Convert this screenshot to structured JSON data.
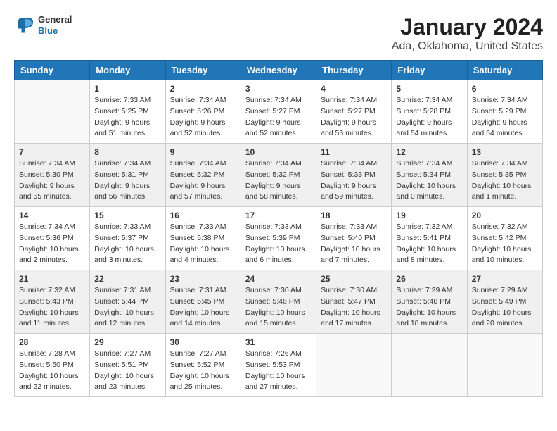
{
  "logo": {
    "line1": "General",
    "line2": "Blue"
  },
  "title": "January 2024",
  "subtitle": "Ada, Oklahoma, United States",
  "weekdays": [
    "Sunday",
    "Monday",
    "Tuesday",
    "Wednesday",
    "Thursday",
    "Friday",
    "Saturday"
  ],
  "weeks": [
    [
      {
        "day": "",
        "empty": true
      },
      {
        "day": "1",
        "sunrise": "Sunrise: 7:33 AM",
        "sunset": "Sunset: 5:25 PM",
        "daylight": "Daylight: 9 hours and 51 minutes."
      },
      {
        "day": "2",
        "sunrise": "Sunrise: 7:34 AM",
        "sunset": "Sunset: 5:26 PM",
        "daylight": "Daylight: 9 hours and 52 minutes."
      },
      {
        "day": "3",
        "sunrise": "Sunrise: 7:34 AM",
        "sunset": "Sunset: 5:27 PM",
        "daylight": "Daylight: 9 hours and 52 minutes."
      },
      {
        "day": "4",
        "sunrise": "Sunrise: 7:34 AM",
        "sunset": "Sunset: 5:27 PM",
        "daylight": "Daylight: 9 hours and 53 minutes."
      },
      {
        "day": "5",
        "sunrise": "Sunrise: 7:34 AM",
        "sunset": "Sunset: 5:28 PM",
        "daylight": "Daylight: 9 hours and 54 minutes."
      },
      {
        "day": "6",
        "sunrise": "Sunrise: 7:34 AM",
        "sunset": "Sunset: 5:29 PM",
        "daylight": "Daylight: 9 hours and 54 minutes."
      }
    ],
    [
      {
        "day": "7",
        "sunrise": "Sunrise: 7:34 AM",
        "sunset": "Sunset: 5:30 PM",
        "daylight": "Daylight: 9 hours and 55 minutes."
      },
      {
        "day": "8",
        "sunrise": "Sunrise: 7:34 AM",
        "sunset": "Sunset: 5:31 PM",
        "daylight": "Daylight: 9 hours and 56 minutes."
      },
      {
        "day": "9",
        "sunrise": "Sunrise: 7:34 AM",
        "sunset": "Sunset: 5:32 PM",
        "daylight": "Daylight: 9 hours and 57 minutes."
      },
      {
        "day": "10",
        "sunrise": "Sunrise: 7:34 AM",
        "sunset": "Sunset: 5:32 PM",
        "daylight": "Daylight: 9 hours and 58 minutes."
      },
      {
        "day": "11",
        "sunrise": "Sunrise: 7:34 AM",
        "sunset": "Sunset: 5:33 PM",
        "daylight": "Daylight: 9 hours and 59 minutes."
      },
      {
        "day": "12",
        "sunrise": "Sunrise: 7:34 AM",
        "sunset": "Sunset: 5:34 PM",
        "daylight": "Daylight: 10 hours and 0 minutes."
      },
      {
        "day": "13",
        "sunrise": "Sunrise: 7:34 AM",
        "sunset": "Sunset: 5:35 PM",
        "daylight": "Daylight: 10 hours and 1 minute."
      }
    ],
    [
      {
        "day": "14",
        "sunrise": "Sunrise: 7:34 AM",
        "sunset": "Sunset: 5:36 PM",
        "daylight": "Daylight: 10 hours and 2 minutes."
      },
      {
        "day": "15",
        "sunrise": "Sunrise: 7:33 AM",
        "sunset": "Sunset: 5:37 PM",
        "daylight": "Daylight: 10 hours and 3 minutes."
      },
      {
        "day": "16",
        "sunrise": "Sunrise: 7:33 AM",
        "sunset": "Sunset: 5:38 PM",
        "daylight": "Daylight: 10 hours and 4 minutes."
      },
      {
        "day": "17",
        "sunrise": "Sunrise: 7:33 AM",
        "sunset": "Sunset: 5:39 PM",
        "daylight": "Daylight: 10 hours and 6 minutes."
      },
      {
        "day": "18",
        "sunrise": "Sunrise: 7:33 AM",
        "sunset": "Sunset: 5:40 PM",
        "daylight": "Daylight: 10 hours and 7 minutes."
      },
      {
        "day": "19",
        "sunrise": "Sunrise: 7:32 AM",
        "sunset": "Sunset: 5:41 PM",
        "daylight": "Daylight: 10 hours and 8 minutes."
      },
      {
        "day": "20",
        "sunrise": "Sunrise: 7:32 AM",
        "sunset": "Sunset: 5:42 PM",
        "daylight": "Daylight: 10 hours and 10 minutes."
      }
    ],
    [
      {
        "day": "21",
        "sunrise": "Sunrise: 7:32 AM",
        "sunset": "Sunset: 5:43 PM",
        "daylight": "Daylight: 10 hours and 11 minutes."
      },
      {
        "day": "22",
        "sunrise": "Sunrise: 7:31 AM",
        "sunset": "Sunset: 5:44 PM",
        "daylight": "Daylight: 10 hours and 12 minutes."
      },
      {
        "day": "23",
        "sunrise": "Sunrise: 7:31 AM",
        "sunset": "Sunset: 5:45 PM",
        "daylight": "Daylight: 10 hours and 14 minutes."
      },
      {
        "day": "24",
        "sunrise": "Sunrise: 7:30 AM",
        "sunset": "Sunset: 5:46 PM",
        "daylight": "Daylight: 10 hours and 15 minutes."
      },
      {
        "day": "25",
        "sunrise": "Sunrise: 7:30 AM",
        "sunset": "Sunset: 5:47 PM",
        "daylight": "Daylight: 10 hours and 17 minutes."
      },
      {
        "day": "26",
        "sunrise": "Sunrise: 7:29 AM",
        "sunset": "Sunset: 5:48 PM",
        "daylight": "Daylight: 10 hours and 18 minutes."
      },
      {
        "day": "27",
        "sunrise": "Sunrise: 7:29 AM",
        "sunset": "Sunset: 5:49 PM",
        "daylight": "Daylight: 10 hours and 20 minutes."
      }
    ],
    [
      {
        "day": "28",
        "sunrise": "Sunrise: 7:28 AM",
        "sunset": "Sunset: 5:50 PM",
        "daylight": "Daylight: 10 hours and 22 minutes."
      },
      {
        "day": "29",
        "sunrise": "Sunrise: 7:27 AM",
        "sunset": "Sunset: 5:51 PM",
        "daylight": "Daylight: 10 hours and 23 minutes."
      },
      {
        "day": "30",
        "sunrise": "Sunrise: 7:27 AM",
        "sunset": "Sunset: 5:52 PM",
        "daylight": "Daylight: 10 hours and 25 minutes."
      },
      {
        "day": "31",
        "sunrise": "Sunrise: 7:26 AM",
        "sunset": "Sunset: 5:53 PM",
        "daylight": "Daylight: 10 hours and 27 minutes."
      },
      {
        "day": "",
        "empty": true
      },
      {
        "day": "",
        "empty": true
      },
      {
        "day": "",
        "empty": true
      }
    ]
  ]
}
